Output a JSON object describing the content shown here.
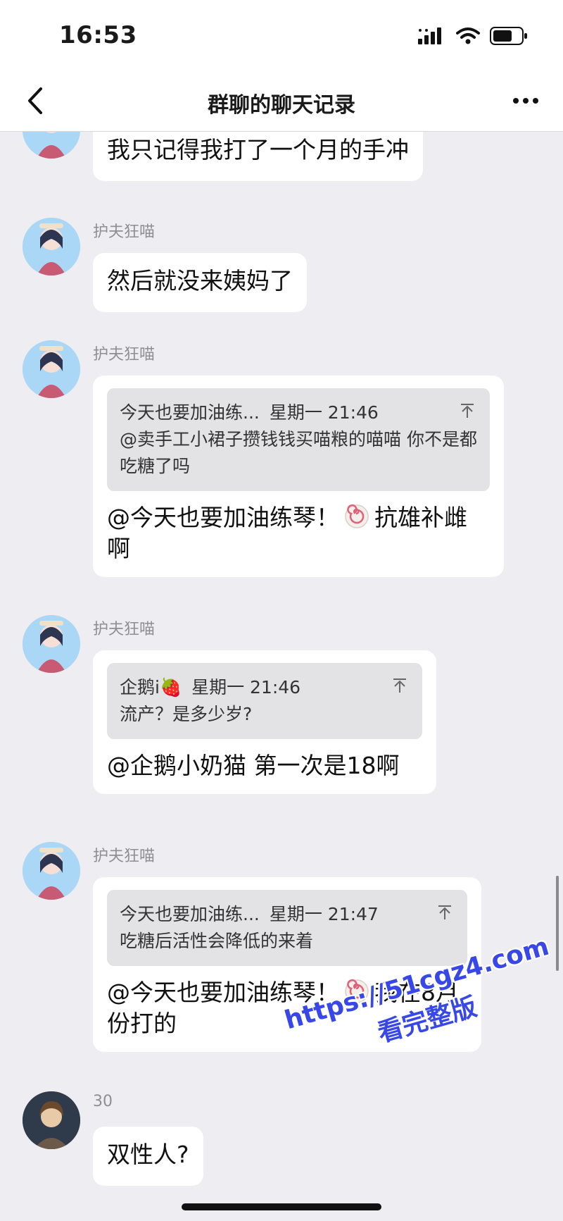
{
  "status_bar": {
    "time": "16:53"
  },
  "nav": {
    "title": "群聊的聊天记录"
  },
  "messages": [
    {
      "text": "我只记得我打了一个月的手冲"
    },
    {
      "sender": "护夫狂喵",
      "text": "然后就没来姨妈了"
    },
    {
      "sender": "护夫狂喵",
      "quote": {
        "author": "今天也要加油练...",
        "time": "星期一 21:46",
        "text": "@卖手工小裙子攒钱钱买喵粮的喵喵 你不是都吃糖了吗"
      },
      "text_before": "@今天也要加油练琴！",
      "text_after": "抗雄补雌啊"
    },
    {
      "sender": "护夫狂喵",
      "quote": {
        "author": "企鹅i🍓",
        "time": "星期一 21:46",
        "text": "流产？是多少岁?"
      },
      "text": "@企鹅小奶猫 第一次是18啊"
    },
    {
      "sender": "护夫狂喵",
      "quote": {
        "author": "今天也要加油练...",
        "time": "星期一 21:47",
        "text": "吃糖后活性会降低的来着"
      },
      "text_before": "@今天也要加油练琴！",
      "text_after": "我在8月份打的"
    },
    {
      "sender": "30",
      "text": "双性人?"
    }
  ],
  "watermark": {
    "line1": "https://51cgz4.com",
    "line2": "看完整版"
  },
  "icons": {
    "back": "chevron-left-icon",
    "more": "more-dots-icon",
    "pin": "pin-to-top-icon",
    "emoji": "candy-emoji-icon"
  }
}
